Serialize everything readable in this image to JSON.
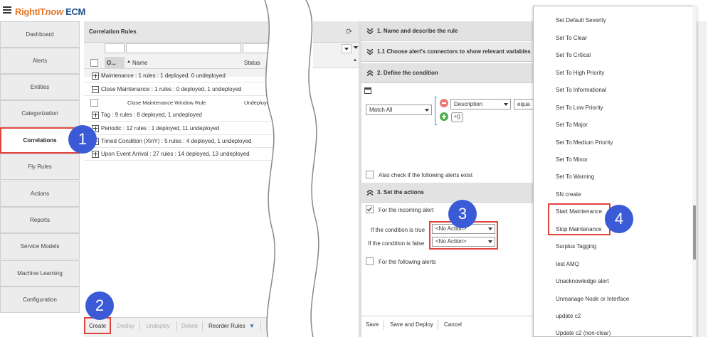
{
  "app": {
    "title_part1": "RightIT",
    "title_part2": "now",
    "title_part3": " ECM"
  },
  "nav": [
    {
      "label": "Dashboard"
    },
    {
      "label": "Alerts"
    },
    {
      "label": "Entities"
    },
    {
      "label": "Categorization"
    },
    {
      "label": "Correlations",
      "active": true
    },
    {
      "label": "Fly Rules"
    },
    {
      "label": "Actions"
    },
    {
      "label": "Reports"
    },
    {
      "label": "Service Models"
    },
    {
      "label": "Machine Learning"
    },
    {
      "label": "Configuration"
    }
  ],
  "correlation": {
    "title": "Correlation Rules",
    "col_order": "O...",
    "col_name": "Name",
    "col_status": "Status",
    "groups": [
      {
        "label": "Maintenance : 1 rules : 1 deployed, 0 undeployed",
        "expanded": false
      },
      {
        "label": "Close Maintenance : 1 rules : 0 deployed, 1 undeployed",
        "expanded": true
      },
      {
        "label": "Tag : 9 rules : 8 deployed, 1 undeployed",
        "expanded": false
      },
      {
        "label": "Periodic : 12 rules : 1 deployed, 11 undeployed",
        "expanded": false
      },
      {
        "label": "Timed Condition (XinY) : 5 rules : 4 deployed, 1 undeployed",
        "expanded": false
      },
      {
        "label": "Upon Event Arrival : 27 rules : 14 deployed, 13 undeployed",
        "expanded": false
      }
    ],
    "child_row": {
      "name": "Close Maintenance Window Rule",
      "status": "Undeployed"
    },
    "buttons": {
      "create": "Create",
      "deploy": "Deploy",
      "undeploy": "Undeploy",
      "delete": "Delete",
      "reorder": "Reorder Rules"
    }
  },
  "rule": {
    "section1": "1. Name and describe the rule",
    "section11": "1.1 Choose alert's connectors to show relevant variables",
    "section2": "2. Define the condition",
    "match": "Match All",
    "field": "Description",
    "operator": "equa",
    "add_label": "+()",
    "also_check": "Also check if the following alerts exist",
    "section3": "3. Set the actions",
    "for_incoming": "For the incoming alert",
    "if_true_label": "If the condition is true",
    "if_true_value": "<No Action>",
    "if_false_label": "If the condition is false",
    "if_false_value": "<No Action>",
    "for_following": "For the following alerts",
    "buttons": {
      "save": "Save",
      "save_deploy": "Save and Deploy",
      "cancel": "Cancel"
    }
  },
  "dropdown": {
    "items": [
      "Set Default Severity",
      "Set To Clear",
      "Set To Critical",
      "Set To High Priority",
      "Set To Informational",
      "Set To Low Priority",
      "Set To Major",
      "Set To Medium Priority",
      "Set To Minor",
      "Set To Warning",
      "SN create",
      "Start Maintenance",
      "Stop Maintenance",
      "Surplus Tagging",
      "test AMQ",
      "Unacknowledge alert",
      "Unmanage Node or Interface",
      "update c2",
      "Update c2 (non-clear)"
    ]
  },
  "callouts": {
    "c1": "1",
    "c2": "2",
    "c3": "3",
    "c4": "4"
  },
  "colors": {
    "accent_red": "#e0443c",
    "callout_blue": "#3b5bd6",
    "logo_orange": "#e8782a",
    "logo_blue": "#1e4f8f"
  }
}
